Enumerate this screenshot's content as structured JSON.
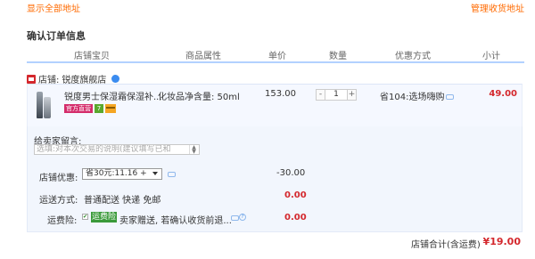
{
  "top_links": {
    "show_all_addresses": "显示全部地址",
    "manage_addresses": "管理收货地址"
  },
  "section_title": "确认订单信息",
  "columns": [
    "店铺宝贝",
    "商品属性",
    "单价",
    "数量",
    "优惠方式",
    "小计"
  ],
  "shop": {
    "label": "店铺:",
    "name": "锐度旗舰店"
  },
  "item": {
    "title": "锐度男士保湿霜保湿补...",
    "attribute": "化妆品净含量: 50ml",
    "tags": [
      "官方直营",
      "7"
    ],
    "price": "153.00",
    "quantity": "1",
    "qty_minus": "-",
    "qty_plus": "+",
    "promotion": "省104:选场嗨购",
    "subtotal": "49.00"
  },
  "message": {
    "label": "给卖家留言:",
    "placeholder": "选填:对本次交易的说明(建议填写已和"
  },
  "shop_discount": {
    "label": "店铺优惠:",
    "selected": "省30元:11.16 +",
    "amount": "-30.00"
  },
  "shipping": {
    "label": "运送方式:",
    "method": "普通配送 快递 免邮",
    "amount": "0.00"
  },
  "insurance": {
    "label": "运费险:",
    "tag": "运费险",
    "text": "卖家赠送, 若确认收货前退...",
    "help": "?",
    "amount": "0.00"
  },
  "total": {
    "label": "店铺合计(含运费)",
    "value": "¥19.00"
  },
  "colors": {
    "accent_orange": "#ff6a00",
    "price_red": "#d4282d",
    "header_blue": "#b2d1ff",
    "panel_blue": "#f2f6fd"
  }
}
